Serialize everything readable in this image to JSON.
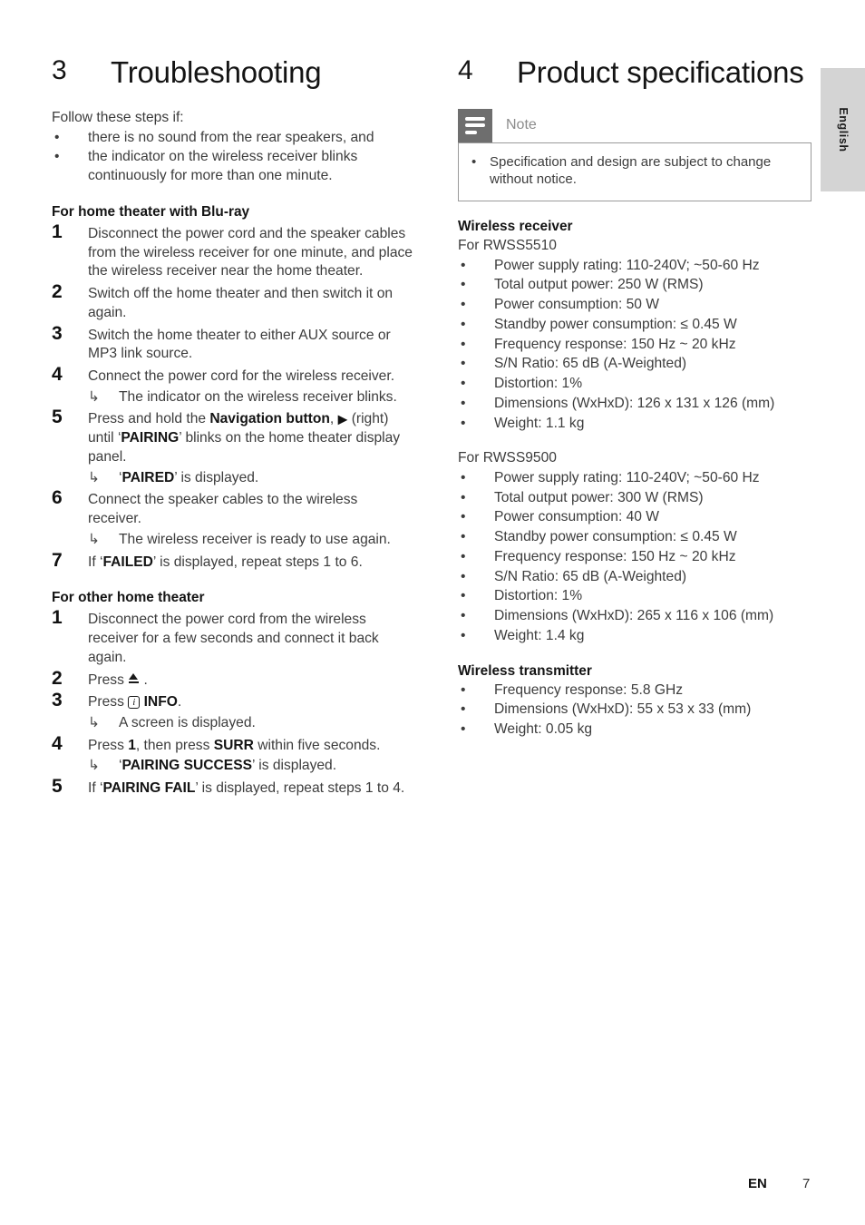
{
  "page": {
    "language_tab": "English",
    "footer_locale": "EN",
    "footer_page_number": "7"
  },
  "left_column": {
    "chapter": {
      "number": "3",
      "title": "Troubleshooting"
    },
    "intro": "Follow these steps if:",
    "intro_bullets": [
      {
        "dot": "•",
        "text": "there is no sound from the rear speakers, and"
      },
      {
        "dot": "•",
        "text": "the indicator on the wireless receiver blinks continuously for more than one minute."
      }
    ],
    "section_bluray": {
      "heading": "For home theater with Blu-ray",
      "steps": [
        {
          "num": "1",
          "text": "Disconnect the power cord and the speaker cables from the wireless receiver for one minute, and place the wireless receiver near the home theater."
        },
        {
          "num": "2",
          "text": "Switch off the home theater and then switch it on again."
        },
        {
          "num": "3",
          "text": "Switch the home theater to either AUX source or MP3 link source."
        },
        {
          "num": "4",
          "text": "Connect the power cord for the wireless receiver.",
          "result": {
            "arrow": "↳",
            "text": "The indicator on the wireless receiver blinks."
          }
        },
        {
          "num": "5",
          "text_pre": "Press and hold the ",
          "text_bold": "Navigation button",
          "text_mid": ", ",
          "glyph": "right-triangle",
          "text_post_a": " (right) until ‘",
          "text_bold_b": "PAIRING",
          "text_post_b": "’ blinks on the home theater display panel.",
          "result": {
            "arrow": "↳",
            "quote_open": "‘",
            "bold": "PAIRED",
            "quote_close": "’",
            "text": " is displayed."
          }
        },
        {
          "num": "6",
          "text": "Connect the speaker cables to the wireless receiver.",
          "result": {
            "arrow": "↳",
            "text": "The wireless receiver is ready to use again."
          }
        },
        {
          "num": "7",
          "text_pre": "If ‘",
          "text_bold": "FAILED",
          "text_post": "’ is displayed, repeat steps 1 to 6."
        }
      ]
    },
    "section_other": {
      "heading": "For other home theater",
      "steps": [
        {
          "num": "1",
          "text": "Disconnect the power cord from the wireless receiver for a few seconds and connect it back again."
        },
        {
          "num": "2",
          "text_pre": "Press ",
          "glyph": "eject",
          "text_post": " ."
        },
        {
          "num": "3",
          "text_pre": "Press ",
          "glyph": "info",
          "glyph_label": "i",
          "text_bold": " INFO",
          "text_post": ".",
          "result": {
            "arrow": "↳",
            "text": "A screen is displayed."
          }
        },
        {
          "num": "4",
          "text_pre": "Press ",
          "text_bold": "1",
          "text_mid": ", then press ",
          "text_bold_b": "SURR",
          "text_post": " within five seconds.",
          "result": {
            "arrow": "↳",
            "quote_open": "‘",
            "bold": "PAIRING SUCCESS",
            "quote_close": "’",
            "text": " is displayed."
          }
        },
        {
          "num": "5",
          "text_pre": "If ‘",
          "text_bold": "PAIRING FAIL",
          "text_post": "’ is displayed, repeat steps 1 to 4."
        }
      ]
    }
  },
  "right_column": {
    "chapter": {
      "number": "4",
      "title": "Product specifications"
    },
    "note": {
      "icon_name": "note-lines-icon",
      "title": "Note",
      "items": [
        {
          "dot": "•",
          "text": "Specification and design are subject to change without notice."
        }
      ]
    },
    "spec_sections": [
      {
        "heading": "Wireless receiver",
        "model_label": "For RWSS5510",
        "items": [
          {
            "dot": "•",
            "text": "Power supply rating: 110-240V; ~50-60 Hz"
          },
          {
            "dot": "•",
            "text": "Total output power: 250 W (RMS)"
          },
          {
            "dot": "•",
            "text": "Power consumption: 50 W"
          },
          {
            "dot": "•",
            "text": "Standby power consumption: ≤ 0.45 W"
          },
          {
            "dot": "•",
            "text": "Frequency response: 150 Hz ~ 20 kHz"
          },
          {
            "dot": "•",
            "text": "S/N Ratio: 65 dB (A-Weighted)"
          },
          {
            "dot": "•",
            "text": "Distortion: 1%"
          },
          {
            "dot": "•",
            "text": "Dimensions (WxHxD): 126 x 131 x 126 (mm)"
          },
          {
            "dot": "•",
            "text": "Weight: 1.1 kg"
          }
        ]
      },
      {
        "heading": "",
        "model_label": "For RWSS9500",
        "items": [
          {
            "dot": "•",
            "text": "Power supply rating: 110-240V; ~50-60 Hz"
          },
          {
            "dot": "•",
            "text": "Total output power: 300 W (RMS)"
          },
          {
            "dot": "•",
            "text": "Power consumption: 40 W"
          },
          {
            "dot": "•",
            "text": "Standby power consumption: ≤ 0.45 W"
          },
          {
            "dot": "•",
            "text": "Frequency response: 150 Hz ~ 20 kHz"
          },
          {
            "dot": "•",
            "text": "S/N Ratio: 65 dB (A-Weighted)"
          },
          {
            "dot": "•",
            "text": "Distortion: 1%"
          },
          {
            "dot": "•",
            "text": "Dimensions (WxHxD): 265 x 116 x 106 (mm)"
          },
          {
            "dot": "•",
            "text": "Weight: 1.4 kg"
          }
        ]
      },
      {
        "heading": "Wireless transmitter",
        "model_label": "",
        "items": [
          {
            "dot": "•",
            "text": "Frequency response: 5.8 GHz"
          },
          {
            "dot": "•",
            "text": "Dimensions (WxHxD): 55 x 53 x 33 (mm)"
          },
          {
            "dot": "•",
            "text": "Weight: 0.05 kg"
          }
        ]
      }
    ]
  }
}
